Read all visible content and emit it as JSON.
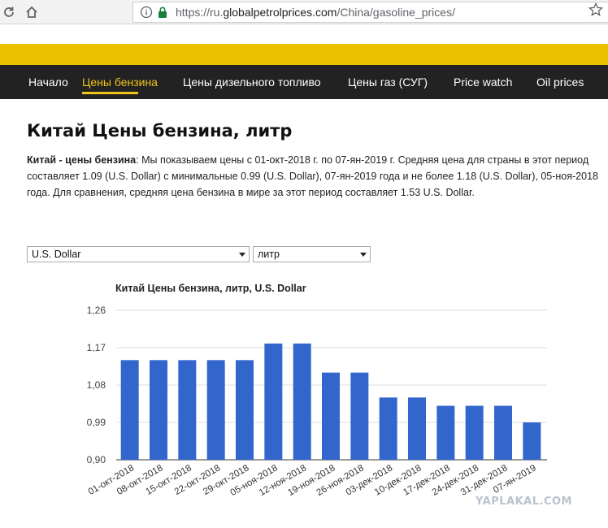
{
  "browser": {
    "url_prefix": "https://ru.",
    "url_host": "globalpetrolprices.com",
    "url_path": "/China/gasoline_prices/"
  },
  "nav": {
    "items": [
      {
        "label": "Начало"
      },
      {
        "label": "Цены бензина"
      },
      {
        "label": "Цены дизельного топливо"
      },
      {
        "label": "Цены газ (СУГ)"
      },
      {
        "label": "Price watch"
      },
      {
        "label": "Oil prices"
      }
    ],
    "active_index": 1
  },
  "page": {
    "title": "Китай Цены бензина, литр",
    "desc_bold": "Китай - цены бензина",
    "desc_text": ": Мы показываем цены с 01-окт-2018 г. по 07-ян-2019 г. Средняя цена для страны в этот период составляет 1.09 (U.S. Dollar) с минимальные 0.99 (U.S. Dollar), 07-ян-2019 года и не более 1.18 (U.S. Dollar), 05-ноя-2018 года. Для сравнения, средняя цена бензина в мире за этот период составляет 1.53 U.S. Dollar."
  },
  "controls": {
    "currency_select": "U.S. Dollar",
    "unit_select": "литр"
  },
  "chart_data": {
    "type": "bar",
    "title": "Китай Цены бензина, литр, U.S. Dollar",
    "categories": [
      "01-окт-2018",
      "08-окт-2018",
      "15-окт-2018",
      "22-окт-2018",
      "29-окт-2018",
      "05-ноя-2018",
      "12-ноя-2018",
      "19-ноя-2018",
      "26-ноя-2018",
      "03-дек-2018",
      "10-дек-2018",
      "17-дек-2018",
      "24-дек-2018",
      "31-дек-2018",
      "07-ян-2019"
    ],
    "values": [
      1.14,
      1.14,
      1.14,
      1.14,
      1.14,
      1.18,
      1.18,
      1.11,
      1.11,
      1.05,
      1.05,
      1.03,
      1.03,
      1.03,
      0.99
    ],
    "ylim": [
      0.9,
      1.26
    ],
    "yticks": [
      "0,90",
      "0,99",
      "1,08",
      "1,17",
      "1,26"
    ],
    "bar_color": "#3366cc",
    "grid": true
  },
  "watermark": "YAPLAKAL.COM",
  "colors": {
    "nav_bg": "#222222",
    "accent": "#f0c419",
    "yellow_band": "#ecc100"
  }
}
